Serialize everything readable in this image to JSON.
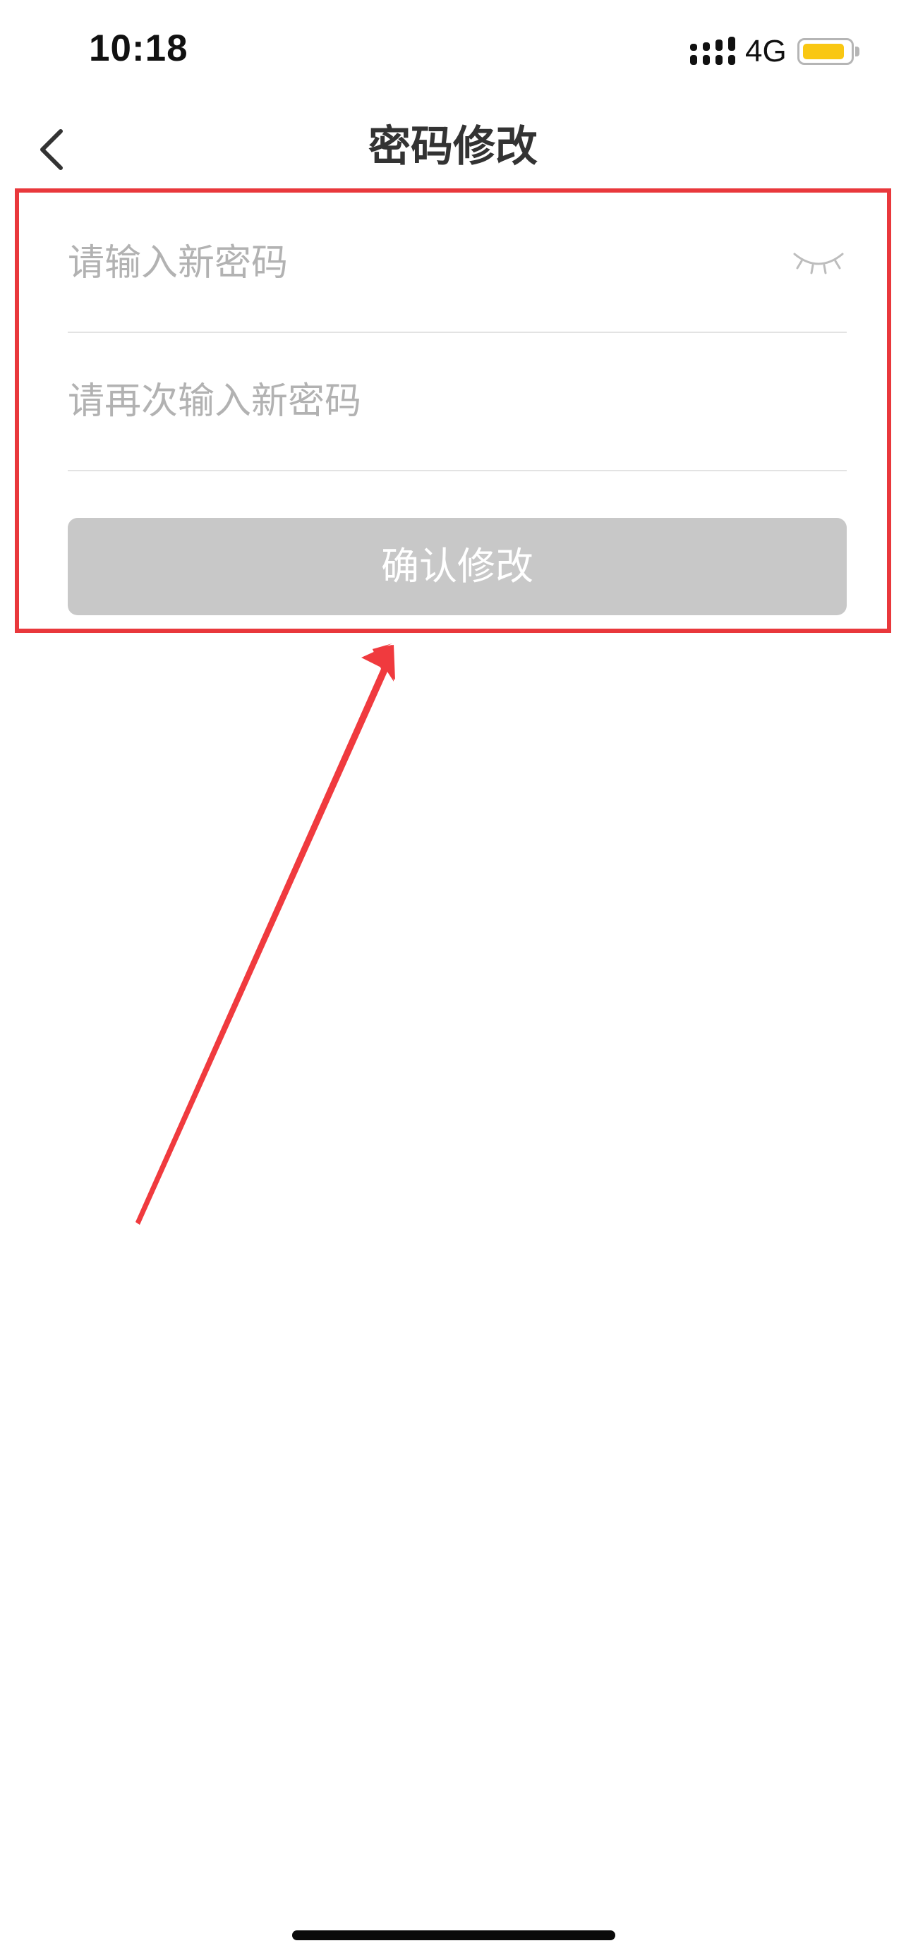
{
  "status_bar": {
    "time": "10:18",
    "network": "4G",
    "battery_level": 0.9,
    "battery_color": "#f9c712"
  },
  "nav": {
    "back_icon": "chevron-left-icon",
    "title": "密码修改"
  },
  "form": {
    "new_password": {
      "value": "",
      "placeholder": "请输入新密码",
      "toggle_icon": "eye-closed-icon"
    },
    "confirm_password": {
      "value": "",
      "placeholder": "请再次输入新密码"
    },
    "submit_label": "确认修改",
    "submit_color": "#c8c8c8"
  },
  "annotation": {
    "color": "#e9383c",
    "shapes": [
      "highlight-box",
      "arrow"
    ]
  }
}
